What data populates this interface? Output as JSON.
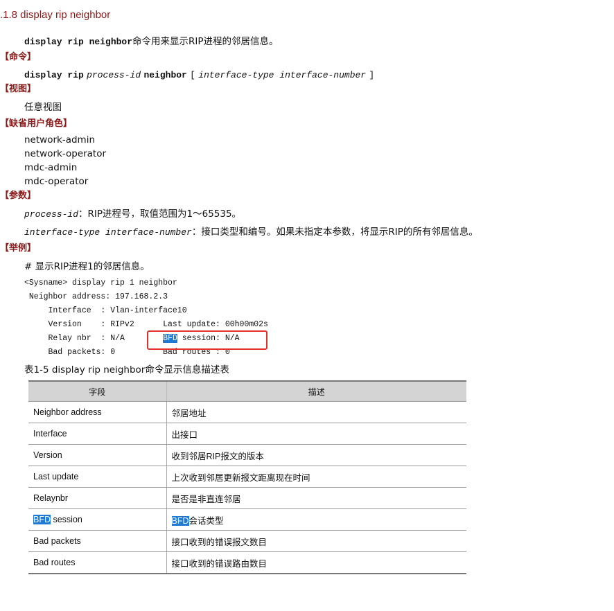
{
  "section": {
    "title": ".1.8  display rip neighbor"
  },
  "intro": {
    "command": "display rip neighbor",
    "text": "命令用来显示RIP进程的邻居信息。"
  },
  "headings": {
    "command": "【命令】",
    "view": "【视图】",
    "role": "【缺省用户角色】",
    "params": "【参数】",
    "example": "【举例】"
  },
  "syntax": {
    "kw1": "display rip",
    "arg1": "process-id",
    "kw2": "neighbor",
    "open": "[",
    "arg2": "interface-type interface-number",
    "close": "]"
  },
  "view": {
    "text": "任意视图"
  },
  "roles": [
    "network-admin",
    "network-operator",
    "mdc-admin",
    "mdc-operator"
  ],
  "params": [
    {
      "name": "process-id",
      "desc": "：RIP进程号，取值范围为1～65535。"
    },
    {
      "name": "interface-type interface-number",
      "desc": "：接口类型和编号。如果未指定本参数，将显示RIP的所有邻居信息。"
    }
  ],
  "example": {
    "caption": "# 显示RIP进程1的邻居信息。",
    "lines": {
      "l1": "<Sysname> display rip 1 neighbor",
      "l2": " Neighbor address: 197.168.2.3",
      "l3": "     Interface  : Vlan-interface10",
      "l4": "     Version    : RIPv2      Last update: 00h00m02s",
      "l5a": "     Relay nbr  : N/A        ",
      "l5b": "BFD",
      "l5c": " session: N/A",
      "l6": "     Bad packets: 0          Bad routes : 0"
    }
  },
  "table": {
    "caption": "表1-5 display rip neighbor命令显示信息描述表",
    "headers": [
      "字段",
      "描述"
    ],
    "rows": [
      {
        "field": "Neighbor address",
        "desc": "邻居地址"
      },
      {
        "field": "Interface",
        "desc": "出接口"
      },
      {
        "field": "Version",
        "desc": "收到邻居RIP报文的版本"
      },
      {
        "field": "Last update",
        "desc": "上次收到邻居更新报文距离现在时间"
      },
      {
        "field": "Relaynbr",
        "desc": "是否是非直连邻居"
      },
      {
        "field_hl": "BFD",
        "field_rest": " session",
        "desc_hl": "BFD",
        "desc_rest": "会话类型"
      },
      {
        "field": "Bad packets",
        "desc": "接口收到的错误报文数目"
      },
      {
        "field": "Bad routes",
        "desc": "接口收到的错误路由数目"
      }
    ]
  },
  "colors": {
    "heading": "#8b1a1a",
    "highlight": "#1e7bd1",
    "annotation_box": "#e0322a",
    "table_header_bg": "#d4d4d4"
  }
}
